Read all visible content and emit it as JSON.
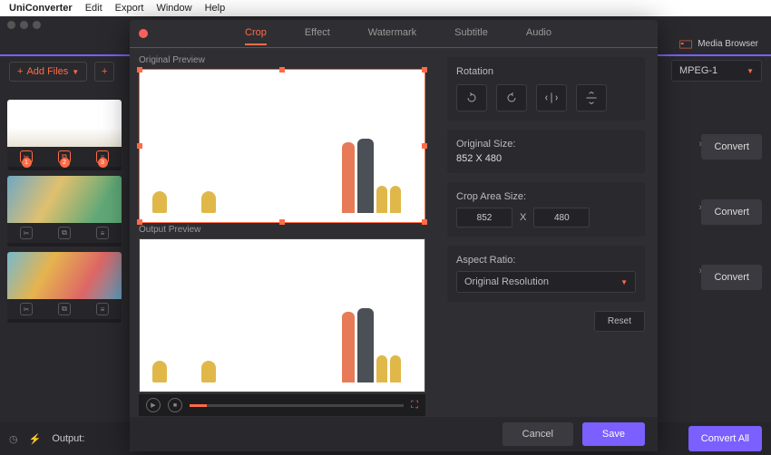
{
  "menubar": {
    "app": "UniConverter",
    "items": [
      "Edit",
      "Export",
      "Window",
      "Help"
    ]
  },
  "topbar": {
    "media_browser": "Media Browser",
    "add_files": "Add Files",
    "format": "MPEG-1"
  },
  "convert": {
    "label": "Convert",
    "all_label": "Convert All"
  },
  "footer": {
    "output": "Output:"
  },
  "modal": {
    "tabs": [
      "Crop",
      "Effect",
      "Watermark",
      "Subtitle",
      "Audio"
    ],
    "active_tab": "Crop",
    "original_preview": "Original Preview",
    "output_preview": "Output Preview",
    "rotation": "Rotation",
    "original_size_label": "Original Size:",
    "original_size": "852 X 480",
    "crop_area_label": "Crop Area Size:",
    "crop_w": "852",
    "crop_by": "X",
    "crop_h": "480",
    "aspect_label": "Aspect Ratio:",
    "aspect_value": "Original Resolution",
    "reset": "Reset",
    "cancel": "Cancel",
    "save": "Save"
  },
  "badges": [
    "1",
    "2",
    "3"
  ]
}
